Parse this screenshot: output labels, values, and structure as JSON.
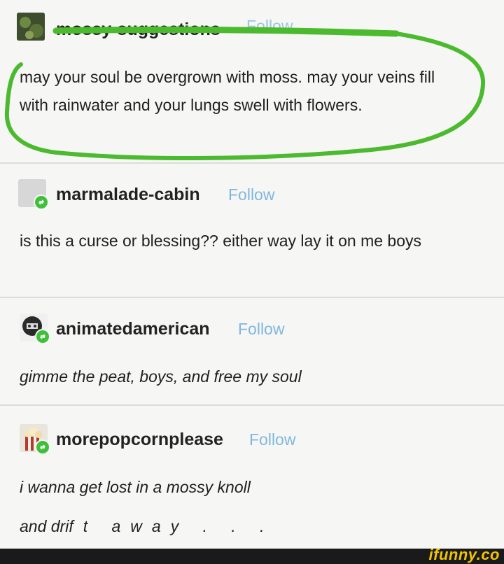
{
  "posts": [
    {
      "username": "mossy-suggestions",
      "follow": "Follow",
      "text": "may your soul be overgrown with moss. may your veins fill with rainwater and your lungs swell with flowers."
    },
    {
      "username": "marmalade-cabin",
      "follow": "Follow",
      "text": "is this a curse or blessing?? either way lay it on me boys"
    },
    {
      "username": "animatedamerican",
      "follow": "Follow",
      "text": "gimme the peat, boys, and free my soul"
    },
    {
      "username": "morepopcornplease",
      "follow": "Follow",
      "text_line1": "i wanna get lost in a mossy knoll",
      "text_line2_a": "and dri",
      "text_line2_b": "ft away . . ."
    }
  ],
  "watermark": "ifunny.co",
  "colors": {
    "accent_green": "#4cba2e",
    "follow_blue": "#7fb8df",
    "reblog_green": "#3fbf3a"
  }
}
